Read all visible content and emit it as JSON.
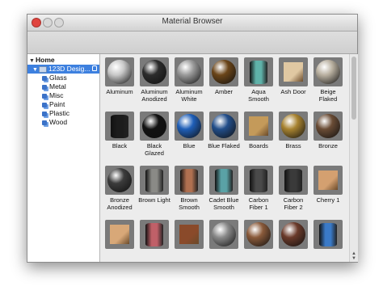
{
  "window": {
    "title": "Material Browser"
  },
  "sidebar": {
    "root": "Home",
    "library": "123D Desig...",
    "items": [
      "Glass",
      "Metal",
      "Misc",
      "Paint",
      "Plastic",
      "Wood"
    ]
  },
  "materials": [
    {
      "label": "Aluminum",
      "shape": "sphere",
      "color": "#c8c8c8"
    },
    {
      "label": "Aluminum Anodized",
      "shape": "sphere",
      "color": "#2c2c2c"
    },
    {
      "label": "Aluminum White",
      "shape": "sphere",
      "color": "#9a9a9a"
    },
    {
      "label": "Amber",
      "shape": "sphere",
      "color": "#6b4519"
    },
    {
      "label": "Aqua Smooth",
      "shape": "cyl",
      "color": "#5fb2a9"
    },
    {
      "label": "Ash Door",
      "shape": "box",
      "color": "#e0c8a2"
    },
    {
      "label": "Beige Flaked",
      "shape": "sphere",
      "color": "#b9b0a0"
    },
    {
      "label": "Black",
      "shape": "cyl",
      "color": "#1c1c1c"
    },
    {
      "label": "Black Glazed",
      "shape": "sphere",
      "color": "#111111"
    },
    {
      "label": "Blue",
      "shape": "sphere",
      "color": "#1f5fb8"
    },
    {
      "label": "Blue Flaked",
      "shape": "sphere",
      "color": "#224e8a"
    },
    {
      "label": "Boards",
      "shape": "box",
      "color": "#c49a5a"
    },
    {
      "label": "Brass",
      "shape": "sphere",
      "color": "#a88330"
    },
    {
      "label": "Bronze",
      "shape": "sphere",
      "color": "#6a4c35"
    },
    {
      "label": "Bronze Anodized",
      "shape": "sphere",
      "color": "#3c3c3c"
    },
    {
      "label": "Brown Light",
      "shape": "cyl",
      "color": "#8a8a86"
    },
    {
      "label": "Brown Smooth",
      "shape": "cyl",
      "color": "#b07050"
    },
    {
      "label": "Cadet Blue Smooth",
      "shape": "cyl",
      "color": "#5aa2a6"
    },
    {
      "label": "Carbon Fiber 1",
      "shape": "cyl",
      "color": "#4a4a4a"
    },
    {
      "label": "Carbon Fiber 2",
      "shape": "cyl",
      "color": "#3a3a3a"
    },
    {
      "label": "Cherry 1",
      "shape": "box",
      "color": "#d4a070"
    },
    {
      "label": "",
      "shape": "box",
      "color": "#d8a878"
    },
    {
      "label": "",
      "shape": "cyl",
      "color": "#c06068"
    },
    {
      "label": "",
      "shape": "box",
      "color": "#8a4a2a"
    },
    {
      "label": "",
      "shape": "sphere",
      "color": "#8a8a8a"
    },
    {
      "label": "",
      "shape": "sphere",
      "color": "#8a5a3a"
    },
    {
      "label": "",
      "shape": "sphere",
      "color": "#6a3a2a"
    },
    {
      "label": "",
      "shape": "cyl",
      "color": "#3a7ac8"
    }
  ]
}
